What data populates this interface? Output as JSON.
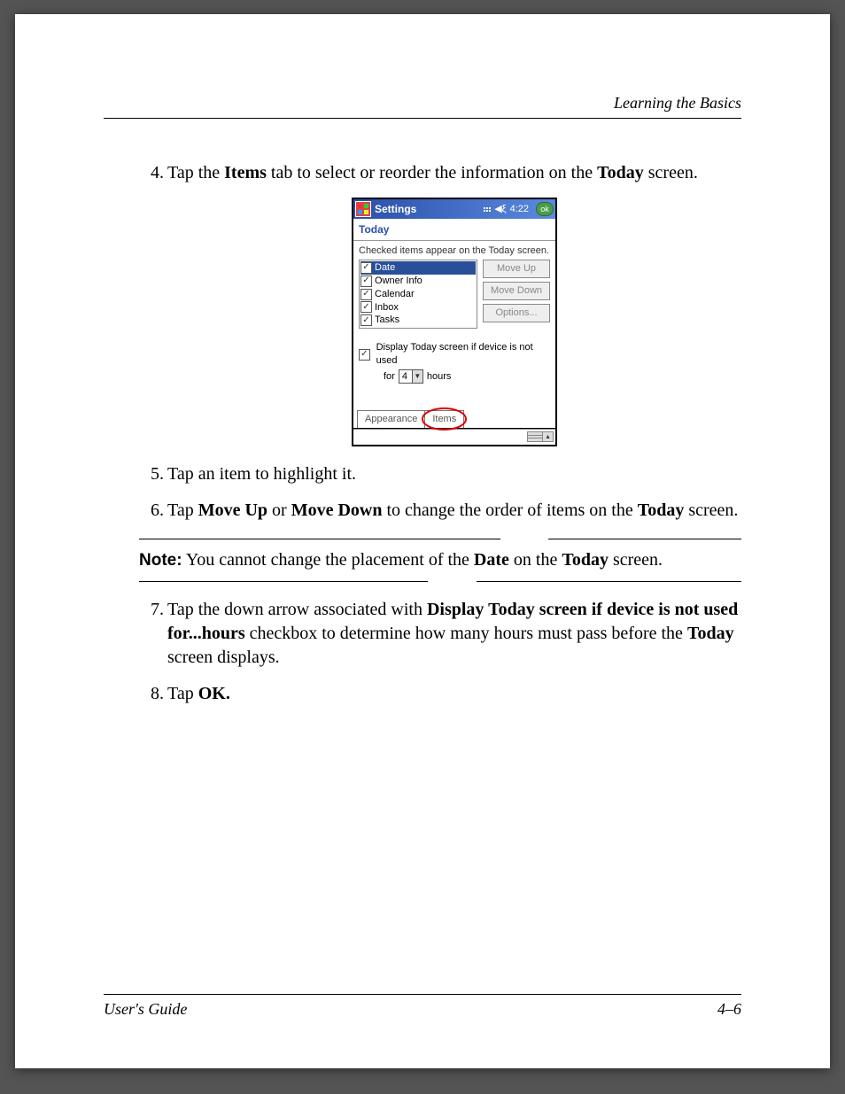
{
  "header": {
    "section_title": "Learning the Basics"
  },
  "steps": {
    "s4": {
      "num": "4.",
      "t1": "Tap the ",
      "b1": "Items",
      "t2": " tab to select or reorder the information on the ",
      "b2": "Today",
      "t3": " screen."
    },
    "s5": {
      "num": "5.",
      "t1": "Tap an item to highlight it."
    },
    "s6": {
      "num": "6.",
      "t1": "Tap ",
      "b1": "Move Up",
      "t2": " or ",
      "b2": "Move Down",
      "t3": " to change the order of items on the ",
      "b3": "Today",
      "t4": " screen."
    },
    "s7": {
      "num": "7.",
      "t1": "Tap the down arrow associated with ",
      "b1": "Display Today screen if device is not used for...hours",
      "t2": " checkbox to determine how many hours must pass before the ",
      "b2": "Today",
      "t3": " screen displays."
    },
    "s8": {
      "num": "8.",
      "t1": "Tap ",
      "b1": "OK."
    }
  },
  "note": {
    "label": "Note:",
    "t1": " You cannot change the placement of the ",
    "b1": "Date",
    "t2": " on the ",
    "b2": "Today",
    "t3": " screen."
  },
  "pda": {
    "title": "Settings",
    "time": "4:22",
    "ok": "ok",
    "subtitle": "Today",
    "caption": "Checked items appear on the Today screen.",
    "items": [
      {
        "label": "Date",
        "selected": true
      },
      {
        "label": "Owner Info",
        "selected": false
      },
      {
        "label": "Calendar",
        "selected": false
      },
      {
        "label": "Inbox",
        "selected": false
      },
      {
        "label": "Tasks",
        "selected": false
      }
    ],
    "buttons": {
      "up": "Move Up",
      "down": "Move Down",
      "options": "Options..."
    },
    "display_label": "Display Today screen if device is not used",
    "for_label": "for",
    "hours_value": "4",
    "hours_label": "hours",
    "tabs": {
      "appearance": "Appearance",
      "items": "Items"
    }
  },
  "footer": {
    "left": "User's Guide",
    "right": "4–6"
  }
}
